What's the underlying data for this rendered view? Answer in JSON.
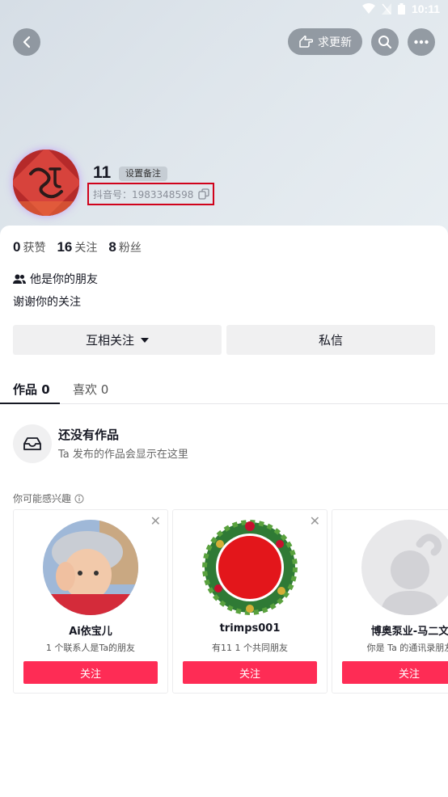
{
  "status_bar": {
    "time": "10:11"
  },
  "top_bar": {
    "update_request_label": "求更新"
  },
  "profile": {
    "nickname": "11",
    "remark_label": "设置备注",
    "douyin_id": "抖音号：1983348598",
    "stats": [
      {
        "value": "0",
        "label": "获赞"
      },
      {
        "value": "16",
        "label": "关注"
      },
      {
        "value": "8",
        "label": "粉丝"
      }
    ],
    "friend_status": "他是你的朋友",
    "bio": "谢谢你的关注"
  },
  "actions": {
    "mutual_follow_label": "互相关注",
    "message_label": "私信"
  },
  "tabs": [
    {
      "label": "作品 0"
    },
    {
      "label": "喜欢 0"
    }
  ],
  "empty_state": {
    "title": "还没有作品",
    "subtitle": "Ta 发布的作品会显示在这里"
  },
  "recommendations": {
    "title": "你可能感兴趣",
    "items": [
      {
        "name": "Ai依宝儿",
        "reason": "1 个联系人是Ta的朋友",
        "follow_label": "关注"
      },
      {
        "name": "trimps001",
        "reason": "有11 1 个共同朋友",
        "follow_label": "关注"
      },
      {
        "name": "博奥泵业-马二文",
        "reason": "你是 Ta 的通讯录朋友",
        "follow_label": "关注"
      }
    ]
  },
  "colors": {
    "accent": "#fe2c55",
    "highlight_box": "#d0021b"
  }
}
